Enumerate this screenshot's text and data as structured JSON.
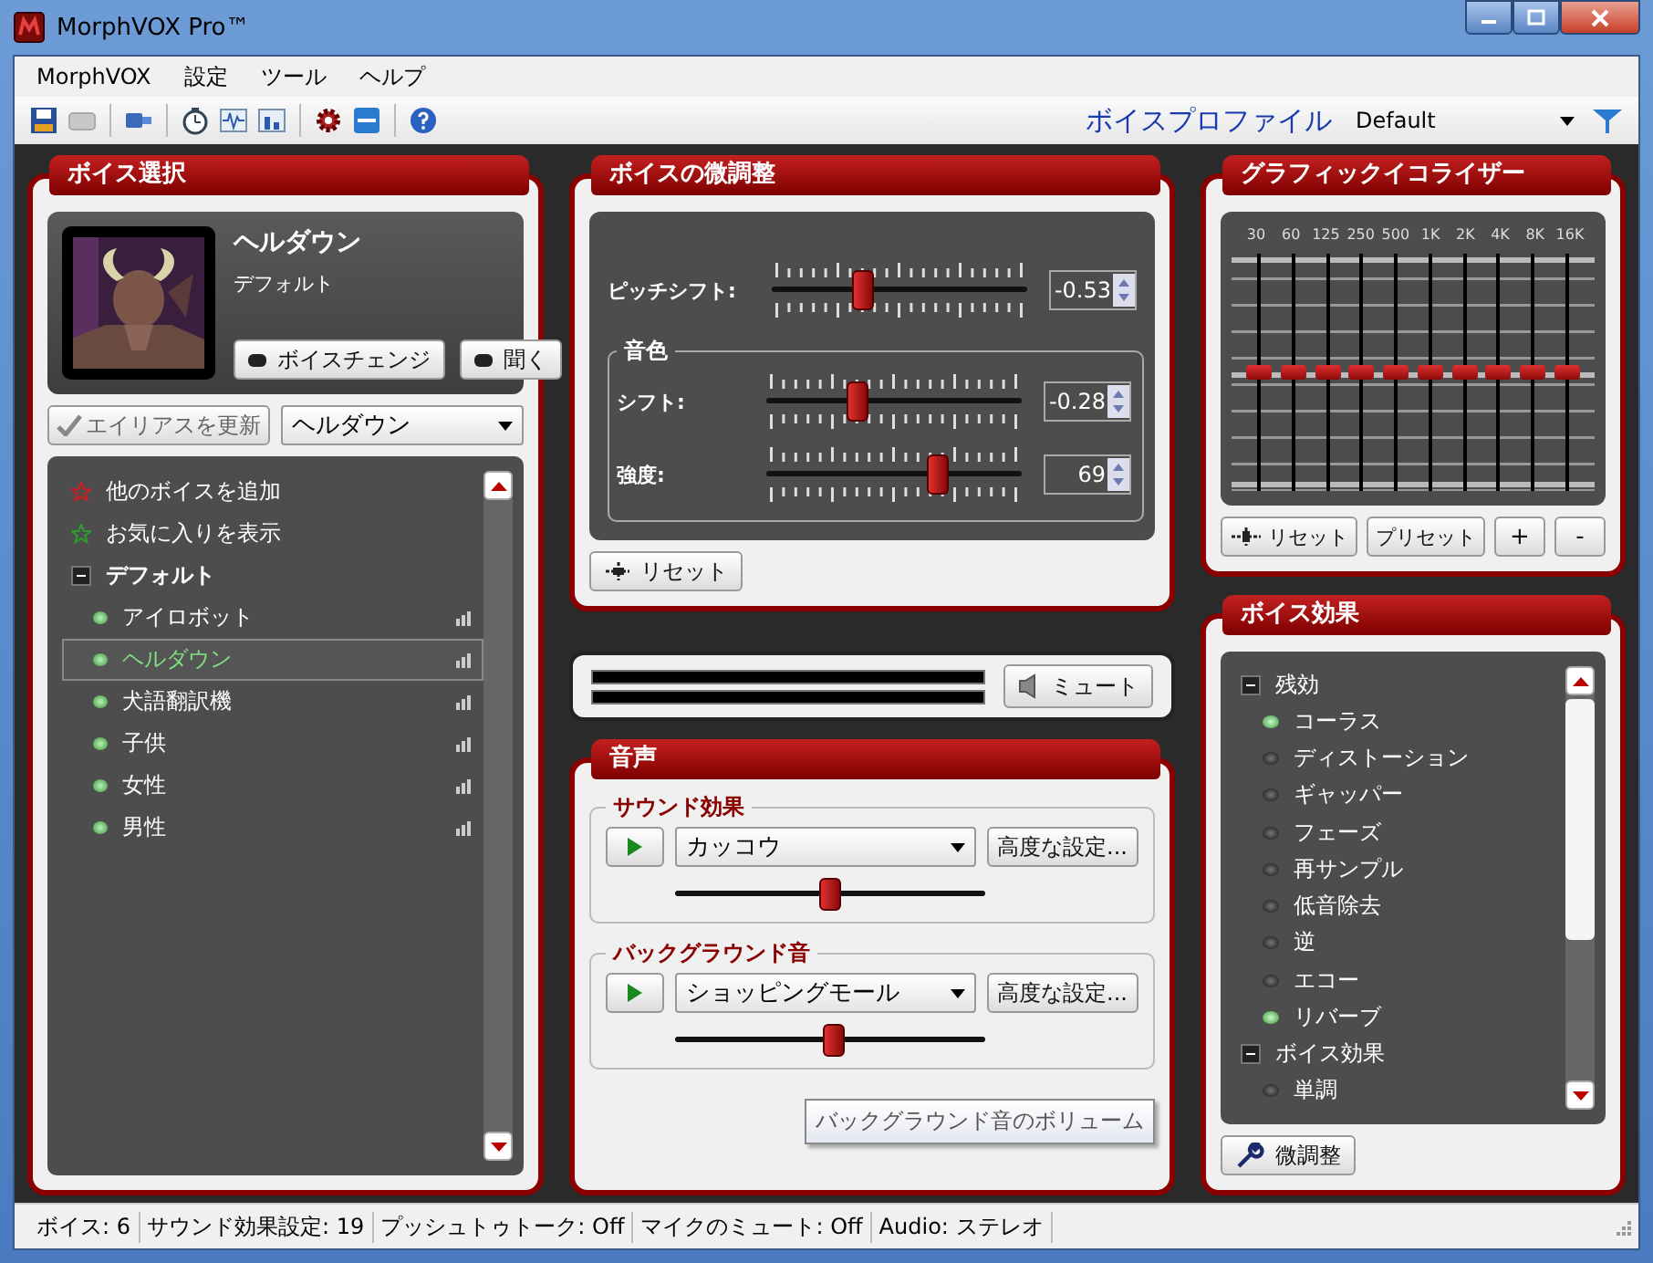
{
  "window": {
    "title": "MorphVOX Pro™"
  },
  "menu": [
    "MorphVOX",
    "設定",
    "ツール",
    "ヘルプ"
  ],
  "toolbar": {
    "profile_label": "ボイスプロファイル",
    "profile": "Default"
  },
  "voice_select": {
    "title": "ボイス選択",
    "voice_name": "ヘルダウン",
    "voice_profile": "デフォルト",
    "change_button": "ボイスチェンジ",
    "listen_button": "聞く",
    "alias_button": "エイリアスを更新",
    "alias_select": "ヘルダウン",
    "list": [
      {
        "kind": "action",
        "label": "他のボイスを追加",
        "color": "#cc2020"
      },
      {
        "kind": "action",
        "label": "お気に入りを表示",
        "color": "#2e9a2e"
      },
      {
        "kind": "group",
        "label": "デフォルト",
        "expanded": true,
        "children": [
          {
            "label": "アイロボット",
            "selected": false
          },
          {
            "label": "ヘルダウン",
            "selected": true
          },
          {
            "label": "犬語翻訳機",
            "selected": false
          },
          {
            "label": "子供",
            "selected": false
          },
          {
            "label": "女性",
            "selected": false
          },
          {
            "label": "男性",
            "selected": false
          }
        ]
      }
    ]
  },
  "fine_tune": {
    "title": "ボイスの微調整",
    "pitch": {
      "label": "ピッチシフト:",
      "level": 0.36,
      "value": "-0.53"
    },
    "timbre": {
      "title": "音色",
      "sliders": [
        {
          "label": "シフト:",
          "level": 0.36,
          "value": "-0.28"
        },
        {
          "label": "強度:",
          "level": 0.67,
          "value": "69"
        }
      ]
    },
    "reset_button": "リセット"
  },
  "meter": {
    "mute_button": "ミュート"
  },
  "sound": {
    "title": "音声",
    "groups": [
      {
        "title": "サウンド効果",
        "selection": "カッコウ",
        "settings_button": "高度な設定...",
        "level": 0.5
      },
      {
        "title": "バックグラウンド音",
        "selection": "ショッピングモール",
        "settings_button": "高度な設定...",
        "level": 0.51
      }
    ],
    "tooltip": "バックグラウンド音のボリューム"
  },
  "equalizer": {
    "title": "グラフィックイコライザー",
    "bands": [
      {
        "label": "30",
        "level": 0.5
      },
      {
        "label": "60",
        "level": 0.5
      },
      {
        "label": "125",
        "level": 0.5
      },
      {
        "label": "250",
        "level": 0.5
      },
      {
        "label": "500",
        "level": 0.5
      },
      {
        "label": "1K",
        "level": 0.5
      },
      {
        "label": "2K",
        "level": 0.5
      },
      {
        "label": "4K",
        "level": 0.5
      },
      {
        "label": "8K",
        "level": 0.5
      },
      {
        "label": "16K",
        "level": 0.5
      }
    ],
    "reset_button": "リセット",
    "preset_button": "プリセット",
    "plus_button": "+",
    "minus_button": "-"
  },
  "effects": {
    "title": "ボイス効果",
    "tree": [
      {
        "label": "残効",
        "expanded": true,
        "children": [
          {
            "label": "コーラス",
            "on": true
          },
          {
            "label": "ディストーション",
            "on": false
          },
          {
            "label": "ギャッパー",
            "on": false
          },
          {
            "label": "フェーズ",
            "on": false
          },
          {
            "label": "再サンプル",
            "on": false
          },
          {
            "label": "低音除去",
            "on": false
          },
          {
            "label": "逆",
            "on": false
          },
          {
            "label": "エコー",
            "on": false
          },
          {
            "label": "リバーブ",
            "on": true
          }
        ]
      },
      {
        "label": "ボイス効果",
        "expanded": true,
        "children": [
          {
            "label": "単調",
            "on": false
          }
        ]
      }
    ],
    "tune_button": "微調整"
  },
  "status_bar": [
    "ボイス: 6",
    "サウンド効果設定: 19",
    "プッシュトゥトーク: Off",
    "マイクのミュート: Off",
    "Audio: ステレオ"
  ]
}
